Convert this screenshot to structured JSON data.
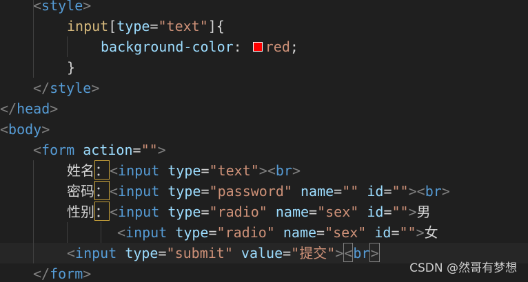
{
  "editor": {
    "swatch_color": "#ff0000",
    "lines": [
      {
        "tokens": [
          {
            "t": "<",
            "c": "bracket"
          },
          {
            "t": "style",
            "c": "tag"
          },
          {
            "t": ">",
            "c": "bracket"
          }
        ]
      },
      {
        "tokens": [
          {
            "t": "input",
            "c": "sel"
          },
          {
            "t": "[",
            "c": "punct"
          },
          {
            "t": "type",
            "c": "attr"
          },
          {
            "t": "=",
            "c": "eq"
          },
          {
            "t": "\"text\"",
            "c": "str"
          },
          {
            "t": "]",
            "c": "punct"
          },
          {
            "t": "{",
            "c": "punct"
          }
        ]
      },
      {
        "tokens": [
          {
            "t": "background-color",
            "c": "prop"
          },
          {
            "t": ": ",
            "c": "punct"
          },
          {
            "swatch": true
          },
          {
            "t": "red",
            "c": "str"
          },
          {
            "t": ";",
            "c": "punct"
          }
        ]
      },
      {
        "tokens": [
          {
            "t": "}",
            "c": "punct"
          }
        ]
      },
      {
        "tokens": [
          {
            "t": "</",
            "c": "bracket"
          },
          {
            "t": "style",
            "c": "tag"
          },
          {
            "t": ">",
            "c": "bracket"
          }
        ]
      },
      {
        "tokens": [
          {
            "t": "</",
            "c": "bracket"
          },
          {
            "t": "head",
            "c": "tag"
          },
          {
            "t": ">",
            "c": "bracket"
          }
        ]
      },
      {
        "tokens": [
          {
            "t": "<",
            "c": "bracket"
          },
          {
            "t": "body",
            "c": "tag"
          },
          {
            "t": ">",
            "c": "bracket"
          }
        ]
      },
      {
        "tokens": [
          {
            "t": "<",
            "c": "bracket"
          },
          {
            "t": "form",
            "c": "tag"
          },
          {
            "t": " "
          },
          {
            "t": "action",
            "c": "attr"
          },
          {
            "t": "=",
            "c": "eq"
          },
          {
            "t": "\"\"",
            "c": "str"
          },
          {
            "t": ">",
            "c": "bracket"
          }
        ]
      },
      {
        "tokens": [
          {
            "t": "姓名",
            "c": "cjk"
          },
          {
            "t": "：",
            "c": "cjk",
            "box": "gold"
          },
          {
            "t": "<",
            "c": "bracket"
          },
          {
            "t": "input",
            "c": "tag"
          },
          {
            "t": " "
          },
          {
            "t": "type",
            "c": "attr"
          },
          {
            "t": "=",
            "c": "eq"
          },
          {
            "t": "\"text\"",
            "c": "str"
          },
          {
            "t": ">",
            "c": "bracket"
          },
          {
            "t": "<",
            "c": "bracket"
          },
          {
            "t": "br",
            "c": "tag"
          },
          {
            "t": ">",
            "c": "bracket"
          }
        ]
      },
      {
        "tokens": [
          {
            "t": "密码",
            "c": "cjk"
          },
          {
            "t": "：",
            "c": "cjk",
            "box": "gold"
          },
          {
            "t": "<",
            "c": "bracket"
          },
          {
            "t": "input",
            "c": "tag"
          },
          {
            "t": " "
          },
          {
            "t": "type",
            "c": "attr"
          },
          {
            "t": "=",
            "c": "eq"
          },
          {
            "t": "\"password\"",
            "c": "str"
          },
          {
            "t": " "
          },
          {
            "t": "name",
            "c": "attr"
          },
          {
            "t": "=",
            "c": "eq"
          },
          {
            "t": "\"\"",
            "c": "str"
          },
          {
            "t": " "
          },
          {
            "t": "id",
            "c": "attr"
          },
          {
            "t": "=",
            "c": "eq"
          },
          {
            "t": "\"\"",
            "c": "str"
          },
          {
            "t": ">",
            "c": "bracket"
          },
          {
            "t": "<",
            "c": "bracket"
          },
          {
            "t": "br",
            "c": "tag"
          },
          {
            "t": ">",
            "c": "bracket"
          }
        ]
      },
      {
        "tokens": [
          {
            "t": "性别",
            "c": "cjk"
          },
          {
            "t": "：",
            "c": "cjk",
            "box": "gold"
          },
          {
            "t": "<",
            "c": "bracket"
          },
          {
            "t": "input",
            "c": "tag"
          },
          {
            "t": " "
          },
          {
            "t": "type",
            "c": "attr"
          },
          {
            "t": "=",
            "c": "eq"
          },
          {
            "t": "\"radio\"",
            "c": "str"
          },
          {
            "t": " "
          },
          {
            "t": "name",
            "c": "attr"
          },
          {
            "t": "=",
            "c": "eq"
          },
          {
            "t": "\"sex\"",
            "c": "str"
          },
          {
            "t": " "
          },
          {
            "t": "id",
            "c": "attr"
          },
          {
            "t": "=",
            "c": "eq"
          },
          {
            "t": "\"\"",
            "c": "str"
          },
          {
            "t": ">",
            "c": "bracket"
          },
          {
            "t": "男",
            "c": "cjk"
          }
        ]
      },
      {
        "tokens": [
          {
            "t": "<",
            "c": "bracket"
          },
          {
            "t": "input",
            "c": "tag"
          },
          {
            "t": " "
          },
          {
            "t": "type",
            "c": "attr"
          },
          {
            "t": "=",
            "c": "eq"
          },
          {
            "t": "\"radio\"",
            "c": "str"
          },
          {
            "t": " "
          },
          {
            "t": "name",
            "c": "attr"
          },
          {
            "t": "=",
            "c": "eq"
          },
          {
            "t": "\"sex\"",
            "c": "str"
          },
          {
            "t": " "
          },
          {
            "t": "id",
            "c": "attr"
          },
          {
            "t": "=",
            "c": "eq"
          },
          {
            "t": "\"\"",
            "c": "str"
          },
          {
            "t": ">",
            "c": "bracket"
          },
          {
            "t": "女",
            "c": "cjk"
          }
        ]
      },
      {
        "tokens": [
          {
            "t": "<",
            "c": "bracket"
          },
          {
            "t": "input",
            "c": "tag"
          },
          {
            "t": " "
          },
          {
            "t": "type",
            "c": "attr"
          },
          {
            "t": "=",
            "c": "eq"
          },
          {
            "t": "\"submit\"",
            "c": "str"
          },
          {
            "t": " "
          },
          {
            "t": "value",
            "c": "attr"
          },
          {
            "t": "=",
            "c": "eq"
          },
          {
            "t": "\"提交\"",
            "c": "str"
          },
          {
            "t": ">",
            "c": "bracket"
          },
          {
            "t": "<",
            "c": "bracket",
            "box": "grey"
          },
          {
            "t": "br",
            "c": "tag"
          },
          {
            "t": ">",
            "c": "bracket",
            "box": "grey"
          }
        ]
      },
      {
        "tokens": [
          {
            "t": "</",
            "c": "bracket"
          },
          {
            "t": "form",
            "c": "tag"
          },
          {
            "t": ">",
            "c": "bracket"
          }
        ]
      }
    ]
  },
  "watermark": {
    "text": "CSDN @然哥有梦想"
  }
}
